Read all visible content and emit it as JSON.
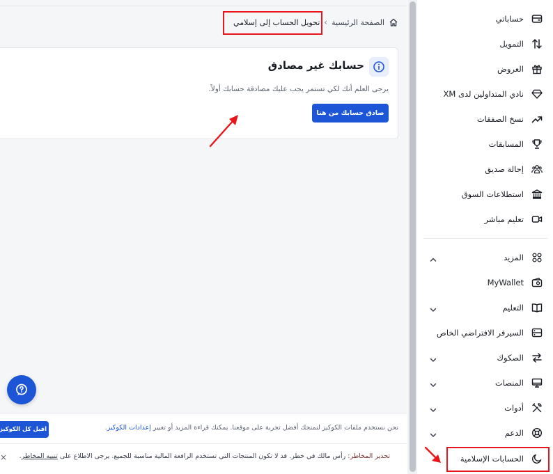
{
  "breadcrumb": {
    "home": "الصفحة الرئيسية",
    "current": "تحويل الحساب إلى إسلامي"
  },
  "notice": {
    "title": "حسابك غير مصادق",
    "description": "يرجى العلم أنك لكي تستمر يجب عليك مصادقة حسابك أولاً.",
    "button": "صادق حسابك من هنا"
  },
  "cookie_bar": {
    "text": "نحن نستخدم ملفات الكوكيز لنمنحك أفضل تجربة على موقعنا. يمكنك قراءة المزيد أو تغيير",
    "link": "إعدادات الكوكيز",
    "accept": "اقبل كل الكوكيز"
  },
  "risk_bar": {
    "label": "تحذير المخاطر:",
    "text": "رأس مالك في خطر. قد لا تكون المنتجات التي تستخدم الرافعة المالية مناسبة للجميع. يرجى الاطلاع على",
    "link": "تنبيه المخاطر",
    "close": "×"
  },
  "sidebar": {
    "items": [
      {
        "label": "حساباتي",
        "icon": "wallet-card-icon"
      },
      {
        "label": "التمويل",
        "icon": "transfer-arrows-icon"
      },
      {
        "label": "العروض",
        "icon": "gift-icon"
      },
      {
        "label": "نادي المتداولين لدى XM",
        "icon": "diamond-icon"
      },
      {
        "label": "نسخ الصفقات",
        "icon": "trend-up-icon"
      },
      {
        "label": "المسابقات",
        "icon": "trophy-icon"
      },
      {
        "label": "إحالة صديق",
        "icon": "users-icon"
      },
      {
        "label": "استطلاعات السوق",
        "icon": "bank-icon"
      },
      {
        "label": "تعليم مباشر",
        "icon": "video-icon"
      },
      {
        "label": "المزيد",
        "icon": "grid-icon"
      },
      {
        "label": "MyWallet",
        "icon": "mywallet-icon"
      },
      {
        "label": "التعليم",
        "icon": "book-icon"
      },
      {
        "label": "السيرفر الافتراضي الخاص",
        "icon": "server-icon"
      },
      {
        "label": "الصكوك",
        "icon": "swap-icon"
      },
      {
        "label": "المنصات",
        "icon": "monitor-icon"
      },
      {
        "label": "أدوات",
        "icon": "tools-icon"
      },
      {
        "label": "الدعم",
        "icon": "lifebuoy-icon"
      },
      {
        "label": "الحسابات الإسلامية",
        "icon": "moon-icon"
      }
    ]
  },
  "colors": {
    "accent": "#1c55d6",
    "annotation": "#e8161b"
  }
}
